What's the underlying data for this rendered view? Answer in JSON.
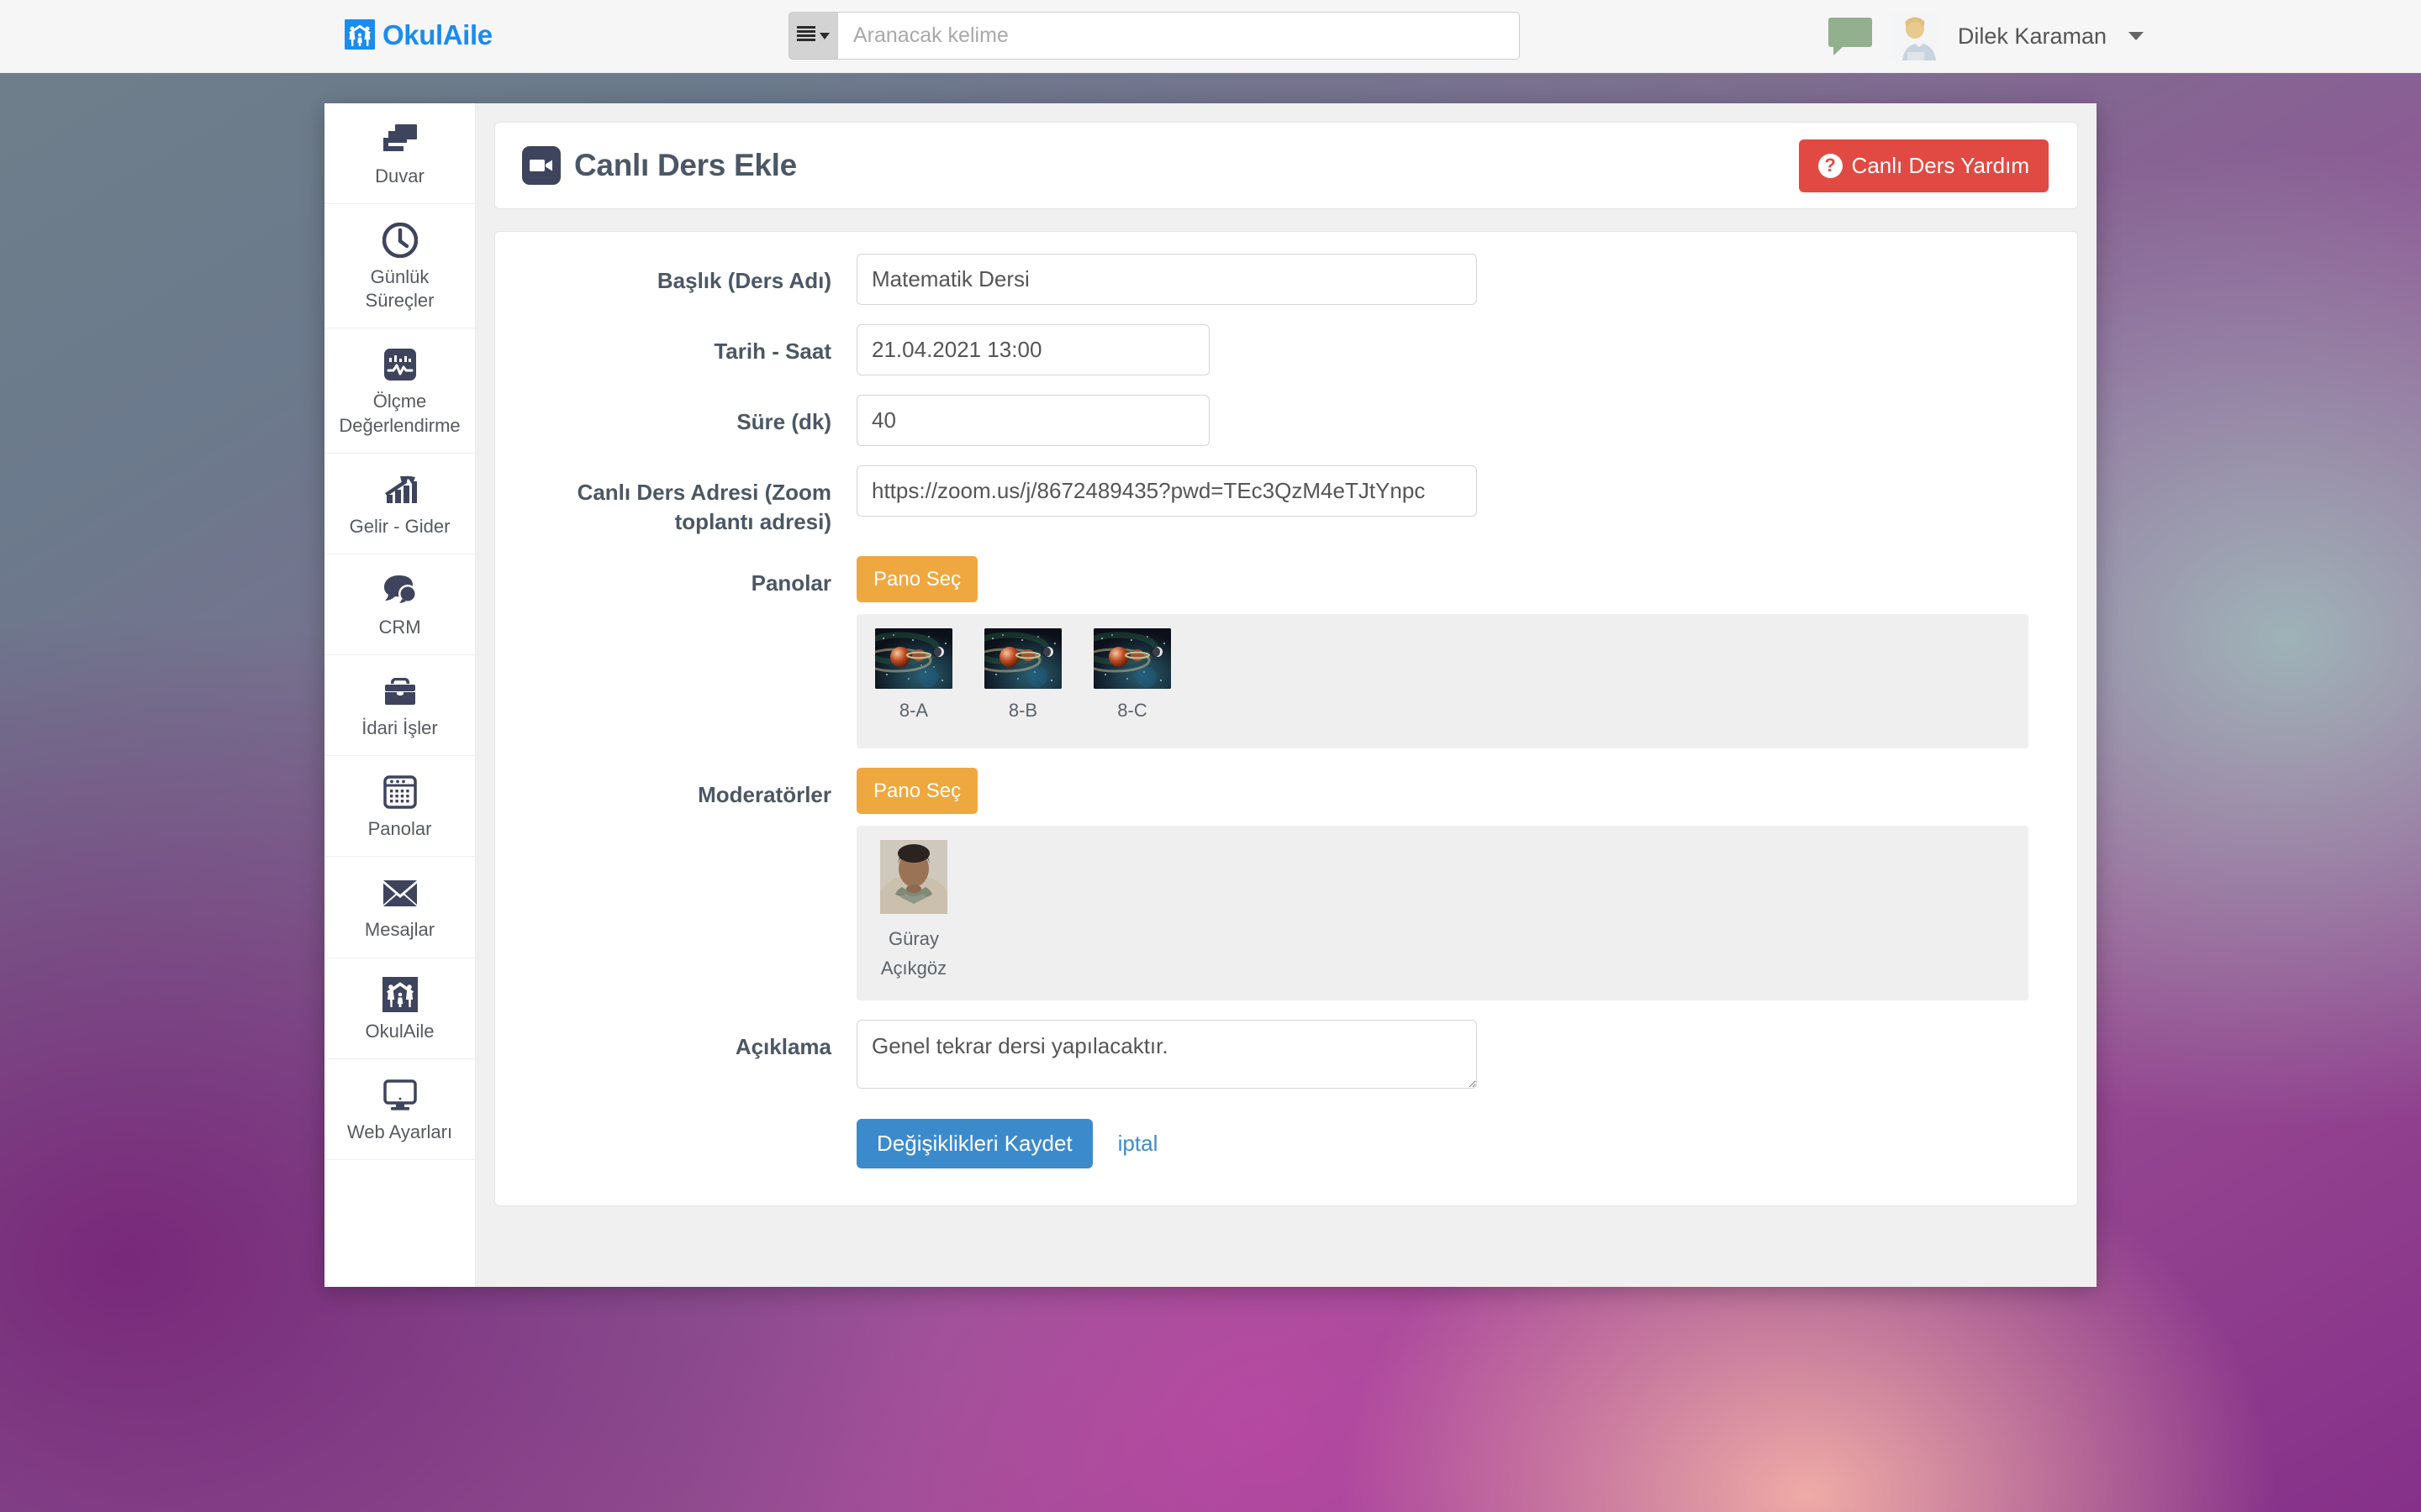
{
  "topbar": {
    "brand": "OkulAile",
    "brand_color": "#1a8cf0",
    "search_dropdown_icon": "list-menu-icon",
    "search_placeholder": "Aranacak kelime",
    "search_value": "",
    "chat_icon": "chat-bubble-icon",
    "user_name": "Dilek Karaman",
    "user_caret_icon": "chevron-down-icon"
  },
  "sidebar": {
    "items": [
      {
        "label": "Duvar",
        "icon": "windows-stack-icon"
      },
      {
        "label": "Günlük\nSüreçler",
        "icon": "clock-icon"
      },
      {
        "label": "Ölçme\nDeğerlendirme",
        "icon": "pulse-chart-icon"
      },
      {
        "label": "Gelir - Gider",
        "icon": "bar-chart-arrow-icon"
      },
      {
        "label": "CRM",
        "icon": "speech-bubbles-icon"
      },
      {
        "label": "İdari İşler",
        "icon": "briefcase-icon"
      },
      {
        "label": "Panolar",
        "icon": "calendar-grid-icon"
      },
      {
        "label": "Mesajlar",
        "icon": "envelope-icon"
      },
      {
        "label": "OkulAile",
        "icon": "family-house-icon"
      },
      {
        "label": "Web Ayarları",
        "icon": "monitor-icon"
      }
    ]
  },
  "header": {
    "icon": "video-camera-icon",
    "title": "Canlı Ders Ekle",
    "help_button_label": "Canlı Ders Yardım",
    "help_button_icon": "question-mark-icon",
    "help_button_color": "#e04a43"
  },
  "form": {
    "title_field": {
      "label": "Başlık (Ders Adı)",
      "value": "Matematik Dersi"
    },
    "datetime_field": {
      "label": "Tarih - Saat",
      "value": "21.04.2021 13:00"
    },
    "duration_field": {
      "label": "Süre (dk)",
      "value": "40"
    },
    "address_field": {
      "label": "Canlı Ders Adresi (Zoom toplantı adresi)",
      "value": "https://zoom.us/j/8672489435?pwd=TEc3QzM4eTJtYnpc"
    },
    "panels_field": {
      "label": "Panolar",
      "select_button_label": "Pano Seç",
      "selected": [
        {
          "caption": "8-A"
        },
        {
          "caption": "8-B"
        },
        {
          "caption": "8-C"
        }
      ]
    },
    "moderators_field": {
      "label": "Moderatörler",
      "select_button_label": "Pano Seç",
      "selected": [
        {
          "caption": "Güray\nAçıkgöz"
        }
      ]
    },
    "description_field": {
      "label": "Açıklama",
      "value": "Genel tekrar dersi yapılacaktır."
    },
    "actions": {
      "save_label": "Değişiklikleri Kaydet",
      "save_color": "#3b8bcc",
      "cancel_label": "iptal"
    }
  }
}
